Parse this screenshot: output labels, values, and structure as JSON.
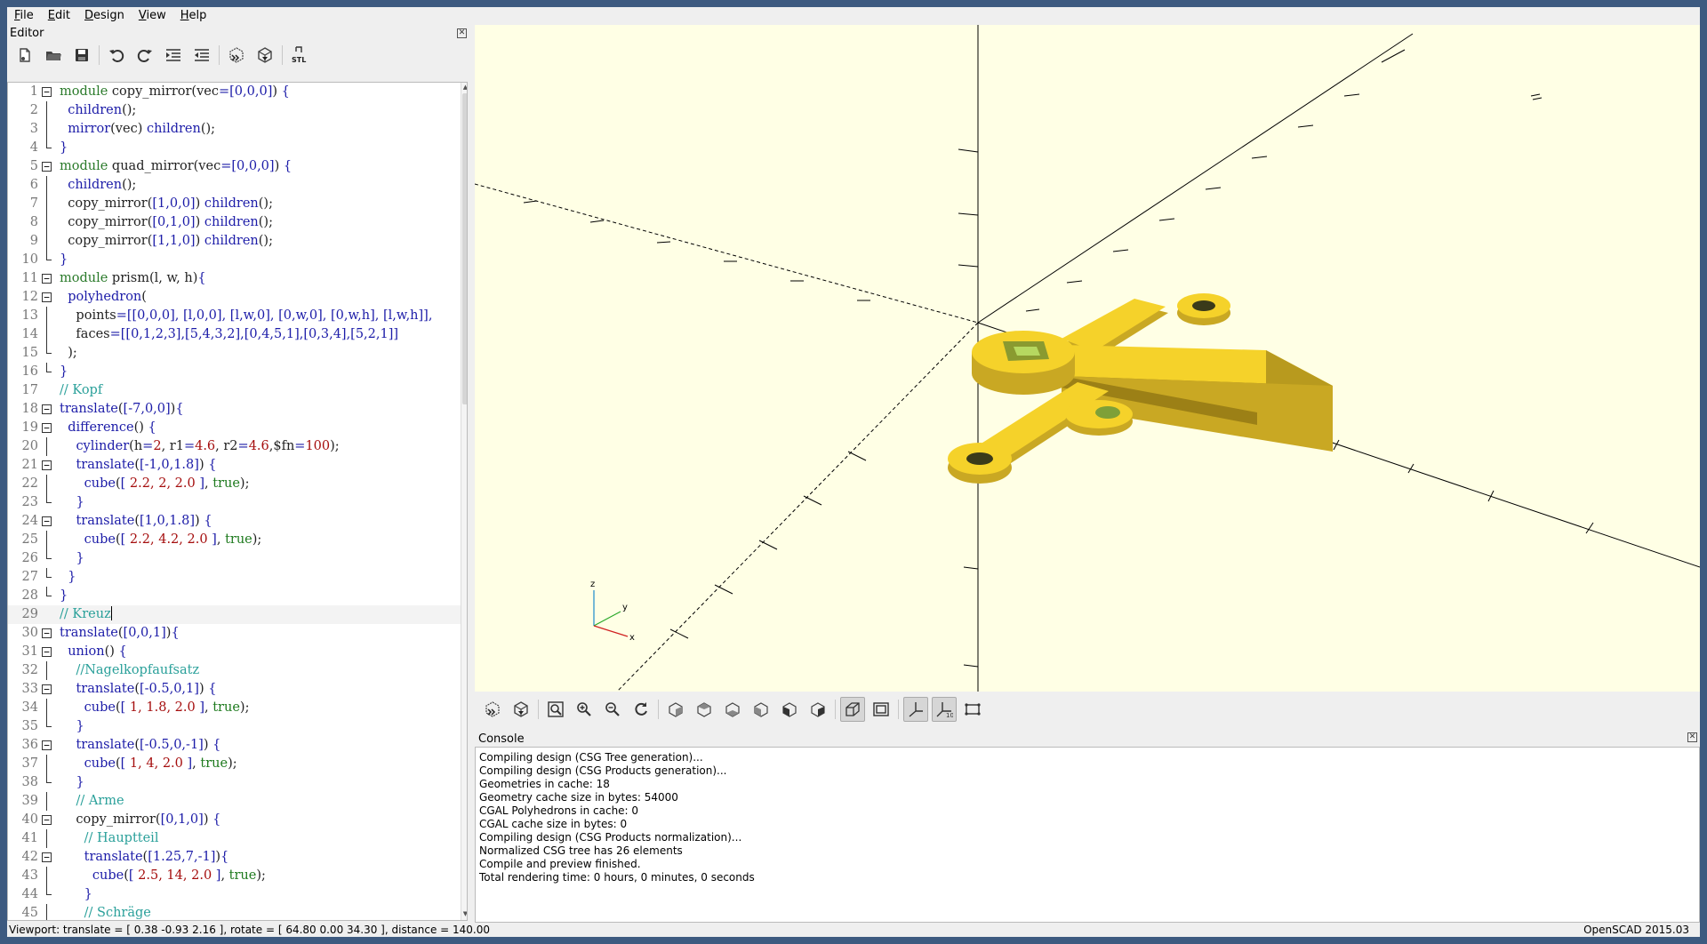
{
  "menu": [
    "File",
    "Edit",
    "Design",
    "View",
    "Help"
  ],
  "editor": {
    "title": "Editor",
    "toolbar": [
      "new-file",
      "open-file",
      "save-file",
      "undo",
      "redo",
      "indent",
      "unindent",
      "preview",
      "render",
      "export-stl"
    ],
    "stl_label": "STL",
    "lines": [
      {
        "n": "1",
        "fold": "open",
        "c": [
          [
            "kw",
            "module"
          ],
          [
            "id",
            " copy_mirror(vec"
          ],
          [
            "fn",
            "="
          ],
          [
            "br",
            "[0,0,0]"
          ],
          [
            "id",
            ") "
          ],
          [
            "br",
            "{"
          ]
        ]
      },
      {
        "n": "2",
        "fold": "line",
        "c": [
          [
            "id",
            "  "
          ],
          [
            "fn",
            "children"
          ],
          [
            "id",
            "();"
          ]
        ]
      },
      {
        "n": "3",
        "fold": "line",
        "c": [
          [
            "id",
            "  "
          ],
          [
            "fn",
            "mirror"
          ],
          [
            "id",
            "(vec) "
          ],
          [
            "fn",
            "children"
          ],
          [
            "id",
            "();"
          ]
        ]
      },
      {
        "n": "4",
        "fold": "end",
        "c": [
          [
            "br",
            "}"
          ]
        ]
      },
      {
        "n": "5",
        "fold": "open",
        "c": [
          [
            "kw",
            "module"
          ],
          [
            "id",
            " quad_mirror(vec"
          ],
          [
            "fn",
            "="
          ],
          [
            "br",
            "[0,0,0]"
          ],
          [
            "id",
            ") "
          ],
          [
            "br",
            "{"
          ]
        ]
      },
      {
        "n": "6",
        "fold": "line",
        "c": [
          [
            "id",
            "  "
          ],
          [
            "fn",
            "children"
          ],
          [
            "id",
            "();"
          ]
        ]
      },
      {
        "n": "7",
        "fold": "line",
        "c": [
          [
            "id",
            "  copy_mirror("
          ],
          [
            "br",
            "[1,0,0]"
          ],
          [
            "id",
            ") "
          ],
          [
            "fn",
            "children"
          ],
          [
            "id",
            "();"
          ]
        ]
      },
      {
        "n": "8",
        "fold": "line",
        "c": [
          [
            "id",
            "  copy_mirror("
          ],
          [
            "br",
            "[0,1,0]"
          ],
          [
            "id",
            ") "
          ],
          [
            "fn",
            "children"
          ],
          [
            "id",
            "();"
          ]
        ]
      },
      {
        "n": "9",
        "fold": "line",
        "c": [
          [
            "id",
            "  copy_mirror("
          ],
          [
            "br",
            "[1,1,0]"
          ],
          [
            "id",
            ") "
          ],
          [
            "fn",
            "children"
          ],
          [
            "id",
            "();"
          ]
        ]
      },
      {
        "n": "10",
        "fold": "end",
        "c": [
          [
            "br",
            "}"
          ]
        ]
      },
      {
        "n": "11",
        "fold": "open",
        "c": [
          [
            "kw",
            "module"
          ],
          [
            "id",
            " prism(l, w, h)"
          ],
          [
            "br",
            "{"
          ]
        ]
      },
      {
        "n": "12",
        "fold": "open2",
        "c": [
          [
            "id",
            "  "
          ],
          [
            "fn",
            "polyhedron"
          ],
          [
            "id",
            "("
          ]
        ]
      },
      {
        "n": "13",
        "fold": "line",
        "c": [
          [
            "id",
            "    points"
          ],
          [
            "fn",
            "="
          ],
          [
            "br",
            "[[0,0,0], [l,0,0], [l,w,0], [0,w,0], [0,w,h], [l,w,h]],"
          ]
        ]
      },
      {
        "n": "14",
        "fold": "line",
        "c": [
          [
            "id",
            "    faces"
          ],
          [
            "fn",
            "="
          ],
          [
            "br",
            "[[0,1,2,3],[5,4,3,2],[0,4,5,1],[0,3,4],[5,2,1]]"
          ]
        ]
      },
      {
        "n": "15",
        "fold": "end",
        "c": [
          [
            "id",
            "  );"
          ]
        ]
      },
      {
        "n": "16",
        "fold": "end",
        "c": [
          [
            "br",
            "}"
          ]
        ]
      },
      {
        "n": "17",
        "fold": "none",
        "c": [
          [
            "cm",
            "// Kopf"
          ]
        ]
      },
      {
        "n": "18",
        "fold": "open",
        "c": [
          [
            "fn",
            "translate"
          ],
          [
            "id",
            "("
          ],
          [
            "br",
            "[-7,0,0]"
          ],
          [
            "id",
            ")"
          ],
          [
            "br",
            "{"
          ]
        ]
      },
      {
        "n": "19",
        "fold": "open2",
        "c": [
          [
            "id",
            "  "
          ],
          [
            "fn",
            "difference"
          ],
          [
            "id",
            "() "
          ],
          [
            "br",
            "{"
          ]
        ]
      },
      {
        "n": "20",
        "fold": "line",
        "c": [
          [
            "id",
            "    "
          ],
          [
            "fn",
            "cylinder"
          ],
          [
            "id",
            "(h"
          ],
          [
            "fn",
            "="
          ],
          [
            "num",
            "2"
          ],
          [
            "id",
            ", r1"
          ],
          [
            "fn",
            "="
          ],
          [
            "num",
            "4.6"
          ],
          [
            "id",
            ", r2"
          ],
          [
            "fn",
            "="
          ],
          [
            "num",
            "4.6"
          ],
          [
            "id",
            ",$fn"
          ],
          [
            "fn",
            "="
          ],
          [
            "num",
            "100"
          ],
          [
            "id",
            ");"
          ]
        ]
      },
      {
        "n": "21",
        "fold": "open2",
        "c": [
          [
            "id",
            "    "
          ],
          [
            "fn",
            "translate"
          ],
          [
            "id",
            "("
          ],
          [
            "br",
            "[-1,0,1.8]"
          ],
          [
            "id",
            ") "
          ],
          [
            "br",
            "{"
          ]
        ]
      },
      {
        "n": "22",
        "fold": "line",
        "c": [
          [
            "id",
            "      "
          ],
          [
            "fn",
            "cube"
          ],
          [
            "id",
            "("
          ],
          [
            "br",
            "["
          ],
          [
            "num",
            " 2.2, 2, 2.0 "
          ],
          [
            "br",
            "]"
          ],
          [
            "id",
            ", "
          ],
          [
            "bool",
            "true"
          ],
          [
            "id",
            ");"
          ]
        ]
      },
      {
        "n": "23",
        "fold": "end",
        "c": [
          [
            "id",
            "    "
          ],
          [
            "br",
            "}"
          ]
        ]
      },
      {
        "n": "24",
        "fold": "open2",
        "c": [
          [
            "id",
            "    "
          ],
          [
            "fn",
            "translate"
          ],
          [
            "id",
            "("
          ],
          [
            "br",
            "[1,0,1.8]"
          ],
          [
            "id",
            ") "
          ],
          [
            "br",
            "{"
          ]
        ]
      },
      {
        "n": "25",
        "fold": "line",
        "c": [
          [
            "id",
            "      "
          ],
          [
            "fn",
            "cube"
          ],
          [
            "id",
            "("
          ],
          [
            "br",
            "["
          ],
          [
            "num",
            " 2.2, 4.2, 2.0 "
          ],
          [
            "br",
            "]"
          ],
          [
            "id",
            ", "
          ],
          [
            "bool",
            "true"
          ],
          [
            "id",
            ");"
          ]
        ]
      },
      {
        "n": "26",
        "fold": "end",
        "c": [
          [
            "id",
            "    "
          ],
          [
            "br",
            "}"
          ]
        ]
      },
      {
        "n": "27",
        "fold": "end",
        "c": [
          [
            "id",
            "  "
          ],
          [
            "br",
            "}"
          ]
        ]
      },
      {
        "n": "28",
        "fold": "end",
        "c": [
          [
            "br",
            "}"
          ]
        ]
      },
      {
        "n": "29",
        "fold": "none",
        "current": true,
        "c": [
          [
            "cm",
            "// Kreuz"
          ]
        ]
      },
      {
        "n": "30",
        "fold": "open",
        "c": [
          [
            "fn",
            "translate"
          ],
          [
            "id",
            "("
          ],
          [
            "br",
            "[0,0,1]"
          ],
          [
            "id",
            ")"
          ],
          [
            "br",
            "{"
          ]
        ]
      },
      {
        "n": "31",
        "fold": "open2",
        "c": [
          [
            "id",
            "  "
          ],
          [
            "fn",
            "union"
          ],
          [
            "id",
            "() "
          ],
          [
            "br",
            "{"
          ]
        ]
      },
      {
        "n": "32",
        "fold": "line",
        "c": [
          [
            "id",
            "    "
          ],
          [
            "cm",
            "//Nagelkopfaufsatz"
          ]
        ]
      },
      {
        "n": "33",
        "fold": "open2",
        "c": [
          [
            "id",
            "    "
          ],
          [
            "fn",
            "translate"
          ],
          [
            "id",
            "("
          ],
          [
            "br",
            "[-0.5,0,1]"
          ],
          [
            "id",
            ") "
          ],
          [
            "br",
            "{"
          ]
        ]
      },
      {
        "n": "34",
        "fold": "line",
        "c": [
          [
            "id",
            "      "
          ],
          [
            "fn",
            "cube"
          ],
          [
            "id",
            "("
          ],
          [
            "br",
            "["
          ],
          [
            "num",
            " 1, 1.8, 2.0 "
          ],
          [
            "br",
            "]"
          ],
          [
            "id",
            ", "
          ],
          [
            "bool",
            "true"
          ],
          [
            "id",
            ");"
          ]
        ]
      },
      {
        "n": "35",
        "fold": "end",
        "c": [
          [
            "id",
            "    "
          ],
          [
            "br",
            "}"
          ]
        ]
      },
      {
        "n": "36",
        "fold": "open2",
        "c": [
          [
            "id",
            "    "
          ],
          [
            "fn",
            "translate"
          ],
          [
            "id",
            "("
          ],
          [
            "br",
            "[-0.5,0,-1]"
          ],
          [
            "id",
            ") "
          ],
          [
            "br",
            "{"
          ]
        ]
      },
      {
        "n": "37",
        "fold": "line",
        "c": [
          [
            "id",
            "      "
          ],
          [
            "fn",
            "cube"
          ],
          [
            "id",
            "("
          ],
          [
            "br",
            "["
          ],
          [
            "num",
            " 1, 4, 2.0 "
          ],
          [
            "br",
            "]"
          ],
          [
            "id",
            ", "
          ],
          [
            "bool",
            "true"
          ],
          [
            "id",
            ");"
          ]
        ]
      },
      {
        "n": "38",
        "fold": "end",
        "c": [
          [
            "id",
            "    "
          ],
          [
            "br",
            "}"
          ]
        ]
      },
      {
        "n": "39",
        "fold": "line",
        "c": [
          [
            "id",
            "    "
          ],
          [
            "cm",
            "// Arme"
          ]
        ]
      },
      {
        "n": "40",
        "fold": "open2",
        "c": [
          [
            "id",
            "    copy_mirror("
          ],
          [
            "br",
            "[0,1,0]"
          ],
          [
            "id",
            ") "
          ],
          [
            "br",
            "{"
          ]
        ]
      },
      {
        "n": "41",
        "fold": "line",
        "c": [
          [
            "id",
            "      "
          ],
          [
            "cm",
            "// Hauptteil"
          ]
        ]
      },
      {
        "n": "42",
        "fold": "open2",
        "c": [
          [
            "id",
            "      "
          ],
          [
            "fn",
            "translate"
          ],
          [
            "id",
            "("
          ],
          [
            "br",
            "[1.25,7,-1]"
          ],
          [
            "id",
            ")"
          ],
          [
            "br",
            "{"
          ]
        ]
      },
      {
        "n": "43",
        "fold": "line",
        "c": [
          [
            "id",
            "        "
          ],
          [
            "fn",
            "cube"
          ],
          [
            "id",
            "("
          ],
          [
            "br",
            "["
          ],
          [
            "num",
            " 2.5, 14, 2.0 "
          ],
          [
            "br",
            "]"
          ],
          [
            "id",
            ", "
          ],
          [
            "bool",
            "true"
          ],
          [
            "id",
            ");"
          ]
        ]
      },
      {
        "n": "44",
        "fold": "end",
        "c": [
          [
            "id",
            "      "
          ],
          [
            "br",
            "}"
          ]
        ]
      },
      {
        "n": "45",
        "fold": "line",
        "c": [
          [
            "id",
            "      "
          ],
          [
            "cm",
            "// Schräge"
          ]
        ]
      }
    ]
  },
  "viewport": {
    "background": "#ffffe5",
    "model_color": "#f5d22a",
    "axis_labels": {
      "z": "z",
      "y": "y",
      "x": "x"
    }
  },
  "view_toolbar": [
    "preview-icon",
    "render-icon",
    "view-all-icon",
    "zoom-in-icon",
    "zoom-out-icon",
    "reset-view-icon",
    "view-right-icon",
    "view-top-icon",
    "view-bottom-icon",
    "view-left-icon",
    "view-front-icon",
    "view-back-icon",
    "perspective-icon",
    "orthogonal-icon",
    "show-axes-icon",
    "show-scale-icon",
    "show-edges-icon"
  ],
  "console": {
    "title": "Console",
    "lines": [
      "Compiling design (CSG Tree generation)...",
      "Compiling design (CSG Products generation)...",
      "Geometries in cache: 18",
      "Geometry cache size in bytes: 54000",
      "CGAL Polyhedrons in cache: 0",
      "CGAL cache size in bytes: 0",
      "Compiling design (CSG Products normalization)...",
      "Normalized CSG tree has 26 elements",
      "Compile and preview finished.",
      "Total rendering time: 0 hours, 0 minutes, 0 seconds"
    ]
  },
  "status": {
    "viewport": "Viewport: translate = [ 0.38 -0.93 2.16 ], rotate = [ 64.80 0.00 34.30 ], distance = 140.00",
    "version": "OpenSCAD 2015.03"
  }
}
